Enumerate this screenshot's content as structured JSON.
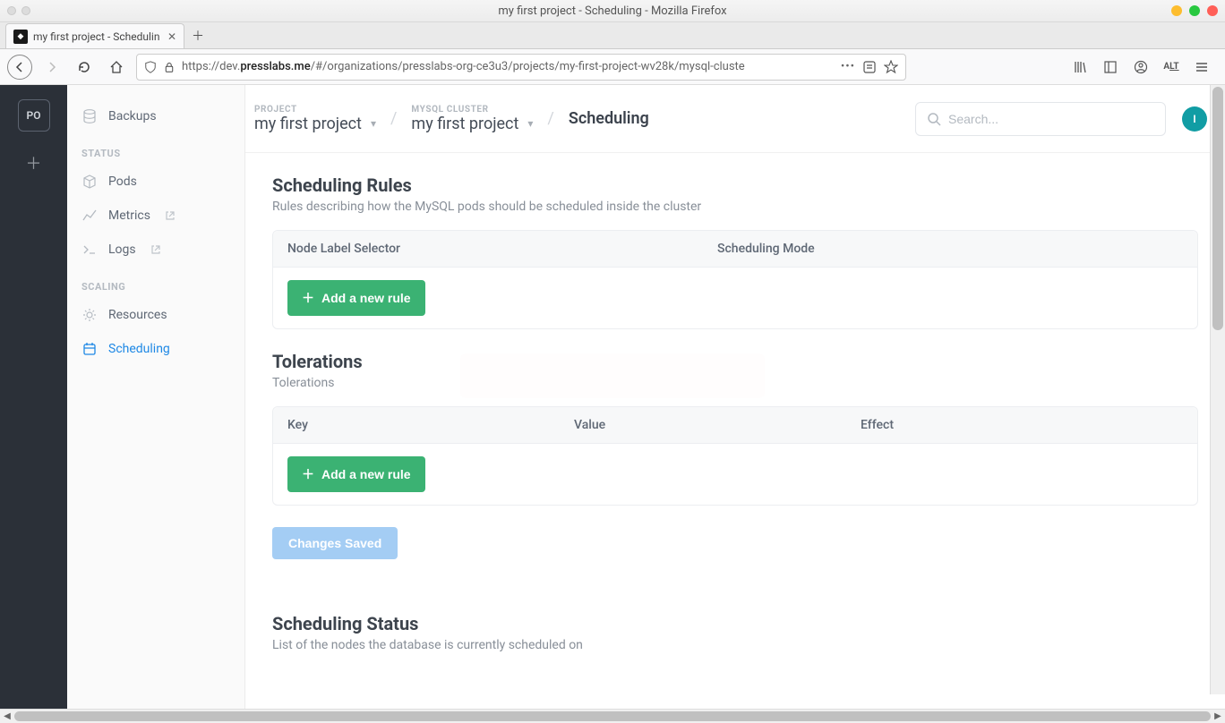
{
  "window": {
    "title": "my first project - Scheduling - Mozilla Firefox"
  },
  "tab": {
    "title": "my first project - Schedulin"
  },
  "url": {
    "protocol": "https://",
    "sub": "dev.",
    "domain": "presslabs.me",
    "path": "/#/organizations/presslabs-org-ce3u3/projects/my-first-project-wv28k/mysql-cluste"
  },
  "rail": {
    "org": "PO"
  },
  "sidebar": {
    "items": [
      {
        "label": "Backups",
        "icon": "database-icon"
      },
      {
        "heading": "STATUS"
      },
      {
        "label": "Pods",
        "icon": "cube-icon"
      },
      {
        "label": "Metrics",
        "icon": "chart-icon",
        "external": true
      },
      {
        "label": "Logs",
        "icon": "terminal-icon",
        "external": true
      },
      {
        "heading": "SCALING"
      },
      {
        "label": "Resources",
        "icon": "gear-icon"
      },
      {
        "label": "Scheduling",
        "icon": "calendar-icon",
        "active": true
      }
    ]
  },
  "breadcrumb": {
    "project_label": "PROJECT",
    "project_value": "my first project",
    "cluster_label": "MYSQL CLUSTER",
    "cluster_value": "my first project",
    "current": "Scheduling"
  },
  "search": {
    "placeholder": "Search..."
  },
  "avatar": {
    "initial": "I"
  },
  "sections": {
    "rules": {
      "title": "Scheduling Rules",
      "subtitle": "Rules describing how the MySQL pods should be scheduled inside the cluster",
      "columns": [
        "Node Label Selector",
        "Scheduling Mode"
      ],
      "add_label": "Add a new rule"
    },
    "tolerations": {
      "title": "Tolerations",
      "subtitle": "Tolerations",
      "columns": [
        "Key",
        "Value",
        "Effect"
      ],
      "add_label": "Add a new rule"
    },
    "saved_label": "Changes Saved",
    "status": {
      "title": "Scheduling Status",
      "subtitle": "List of the nodes the database is currently scheduled on"
    }
  }
}
